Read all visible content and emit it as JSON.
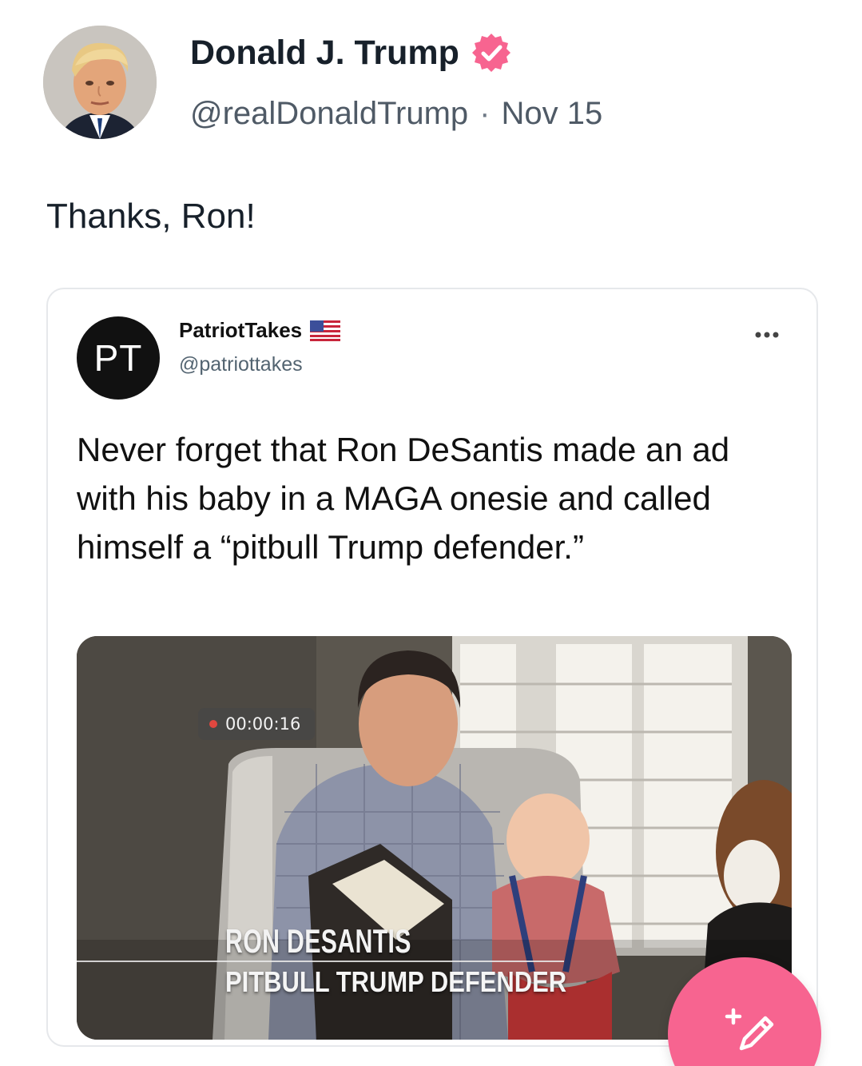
{
  "post": {
    "display_name": "Donald J. Trump",
    "handle": "@realDonaldTrump",
    "separator": "·",
    "date": "Nov 15",
    "text": "Thanks, Ron!",
    "verified_icon": "verified-badge-icon",
    "accent_color": "#f76490"
  },
  "embed": {
    "account_name": "PatriotTakes",
    "account_handle": "@patriottakes",
    "logo_text": "PT",
    "flag_icon": "us-flag-icon",
    "more_icon": "more-options-icon",
    "text": "Never forget that Ron DeSantis made an ad with his baby in a MAGA onesie and called himself a “pitbull Trump defender.”",
    "video": {
      "timer": "00:00:16",
      "caption_name": "RON DESANTIS",
      "caption_title": "PITBULL TRUMP DEFENDER"
    }
  },
  "compose_button": {
    "icon": "compose-icon",
    "color": "#f76490"
  }
}
